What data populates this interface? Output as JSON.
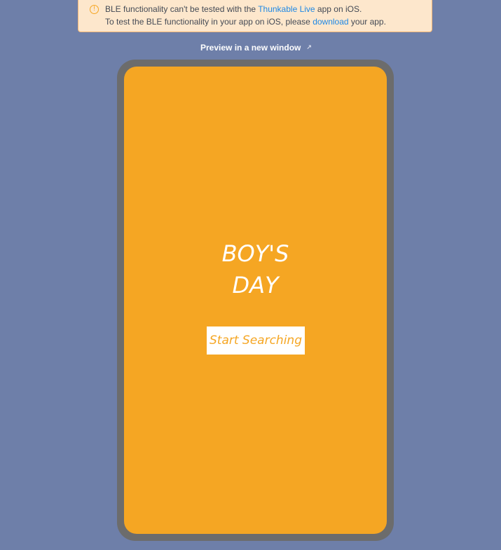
{
  "banner": {
    "icon": "warning-circle-icon",
    "line1_before": "BLE functionality can't be tested with the ",
    "line1_link": "Thunkable Live",
    "line1_after": " app on iOS.",
    "line2_before": "To test the BLE functionality in your app on iOS, please ",
    "line2_link": "download",
    "line2_after": " your app."
  },
  "preview": {
    "label": "Preview in a new window",
    "icon": "external-link-icon"
  },
  "app": {
    "title_line1": "BOY'S",
    "title_line2": "DAY",
    "button_label": "Start Searching"
  },
  "colors": {
    "background": "#6e7fa9",
    "screen": "#f5a623",
    "phone_frame": "#6c6c6c",
    "banner_bg": "#fde7cc",
    "link": "#1e88e5"
  }
}
